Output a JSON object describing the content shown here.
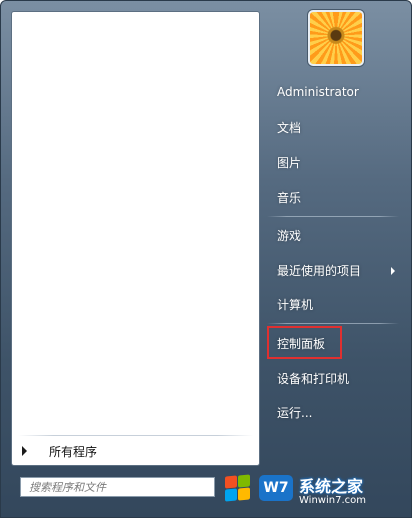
{
  "user": {
    "name": "Administrator"
  },
  "right_items": [
    {
      "label": "文档"
    },
    {
      "label": "图片"
    },
    {
      "label": "音乐"
    },
    {
      "label": "游戏"
    },
    {
      "label": "最近使用的项目"
    },
    {
      "label": "计算机"
    },
    {
      "label": "控制面板"
    },
    {
      "label": "设备和打印机"
    },
    {
      "label": "运行..."
    }
  ],
  "left": {
    "all_programs_label": "所有程序"
  },
  "search": {
    "placeholder": "搜索程序和文件"
  },
  "watermark": {
    "title": "系统之家",
    "url": "Winwin7.com",
    "badge": "W7"
  },
  "colors": {
    "highlight": "#e03030",
    "accent": "#1a73c9"
  },
  "icons": {
    "user_picture": "flower-picture",
    "windows_logo": "windows-logo-icon",
    "submenu": "chevron-right-icon",
    "all_programs": "arrow-right-icon"
  }
}
